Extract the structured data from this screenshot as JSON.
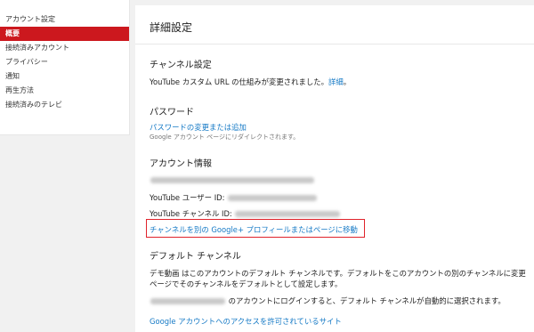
{
  "sidebar": {
    "items": [
      {
        "label": "アカウント設定"
      },
      {
        "label": "概要"
      },
      {
        "label": "接続済みアカウント"
      },
      {
        "label": "プライバシー"
      },
      {
        "label": "通知"
      },
      {
        "label": "再生方法"
      },
      {
        "label": "接続済みのテレビ"
      }
    ]
  },
  "main": {
    "title": "詳細設定",
    "channel_settings": {
      "heading": "チャンネル設定",
      "text": "YouTube カスタム URL の仕組みが変更されました。",
      "link": "詳細",
      "suffix": "。"
    },
    "password": {
      "heading": "パスワード",
      "link": "パスワードの変更または追加",
      "note": "Google アカウント ページにリダイレクトされます。"
    },
    "account_info": {
      "heading": "アカウント情報",
      "user_id_label": "YouTube ユーザー ID:",
      "channel_id_label": "YouTube チャンネル ID:",
      "move_link": "チャンネルを別の Google+ プロフィールまたはページに移動"
    },
    "default_channel": {
      "heading": "デフォルト チャンネル",
      "line1": "デモ動画 はこのアカウントのデフォルト チャンネルです。デフォルトをこのアカウントの別のチャンネルに変更",
      "line2": "ページでそのチャンネルをデフォルトとして設定します。",
      "login_text": "のアカウントにログインすると、デフォルト チャンネルが自動的に選択されます。"
    },
    "access_link": "Google アカウントへのアクセスを許可されているサイト"
  },
  "colors": {
    "accent_red": "#cc181e",
    "link_blue": "#167ac6",
    "highlight_box": "#e0232b"
  }
}
